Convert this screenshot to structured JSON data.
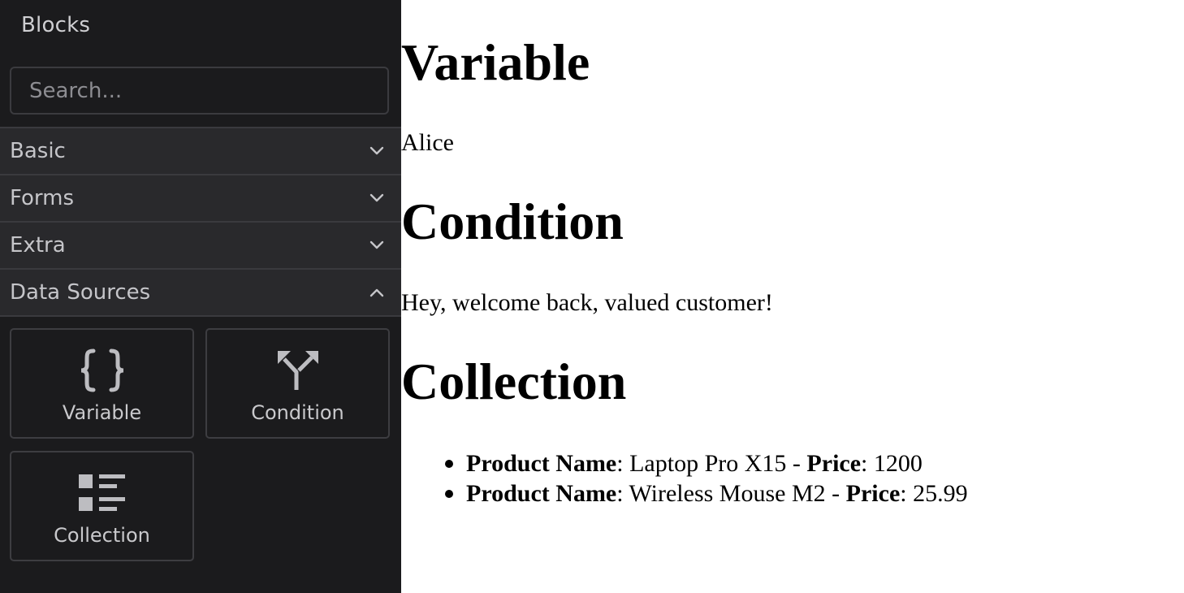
{
  "panel": {
    "title": "Blocks",
    "search_placeholder": "Search..."
  },
  "categories": [
    {
      "label": "Basic",
      "state": "collapsed"
    },
    {
      "label": "Forms",
      "state": "collapsed"
    },
    {
      "label": "Extra",
      "state": "collapsed"
    },
    {
      "label": "Data Sources",
      "state": "expanded"
    }
  ],
  "blocks": [
    {
      "label": "Variable",
      "icon": "braces-icon"
    },
    {
      "label": "Condition",
      "icon": "fork-arrow-icon"
    },
    {
      "label": "Collection",
      "icon": "list-icon"
    }
  ],
  "canvas": {
    "variable_heading": "Variable",
    "variable_value": "Alice",
    "condition_heading": "Condition",
    "condition_text": "Hey, welcome back, valued customer!",
    "collection_heading": "Collection",
    "items": [
      {
        "name_label": "Product Name",
        "name": "Laptop Pro X15",
        "price_label": "Price",
        "price": "1200"
      },
      {
        "name_label": "Product Name",
        "name": "Wireless Mouse M2",
        "price_label": "Price",
        "price": "25.99"
      }
    ]
  },
  "colors": {
    "sidebar_bg": "#1b1b1d",
    "category_bg": "#29292c",
    "border": "#3a3a3e",
    "text": "#c9c9cc"
  }
}
